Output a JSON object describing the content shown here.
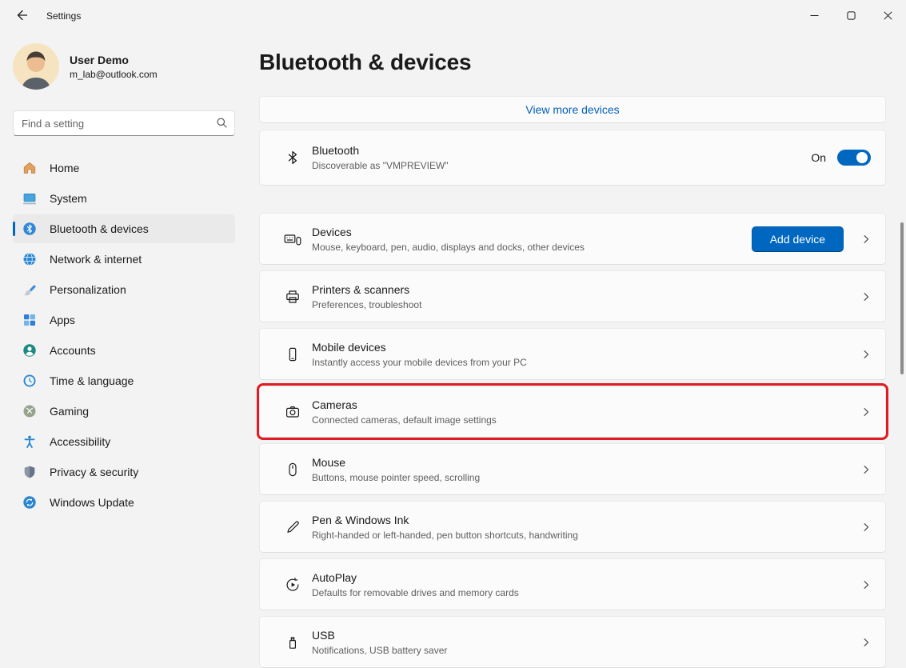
{
  "titlebar": {
    "title": "Settings",
    "controls": [
      {
        "icon": "minimize-icon"
      },
      {
        "icon": "maximize-icon"
      },
      {
        "icon": "close-icon"
      }
    ],
    "back_icon": "back-arrow-icon"
  },
  "user": {
    "name": "User Demo",
    "email": "m_lab@outlook.com",
    "avatar_icon": "user-avatar"
  },
  "search": {
    "placeholder": "Find a setting",
    "icon": "search-icon"
  },
  "sidebar": {
    "items": [
      {
        "label": "Home",
        "icon": "home-icon",
        "selected": false
      },
      {
        "label": "System",
        "icon": "system-icon",
        "selected": false
      },
      {
        "label": "Bluetooth & devices",
        "icon": "bluetooth-icon",
        "selected": true
      },
      {
        "label": "Network & internet",
        "icon": "network-icon",
        "selected": false
      },
      {
        "label": "Personalization",
        "icon": "personalization-icon",
        "selected": false
      },
      {
        "label": "Apps",
        "icon": "apps-icon",
        "selected": false
      },
      {
        "label": "Accounts",
        "icon": "accounts-icon",
        "selected": false
      },
      {
        "label": "Time & language",
        "icon": "time-language-icon",
        "selected": false
      },
      {
        "label": "Gaming",
        "icon": "gaming-icon",
        "selected": false
      },
      {
        "label": "Accessibility",
        "icon": "accessibility-icon",
        "selected": false
      },
      {
        "label": "Privacy & security",
        "icon": "privacy-icon",
        "selected": false
      },
      {
        "label": "Windows Update",
        "icon": "windows-update-icon",
        "selected": false
      }
    ]
  },
  "main": {
    "page_title": "Bluetooth & devices",
    "view_more_label": "View more devices",
    "bluetooth": {
      "title": "Bluetooth",
      "subtitle": "Discoverable as \"VMPREVIEW\"",
      "status_label": "On",
      "toggle_state": true,
      "icon": "bluetooth-glyph-icon"
    },
    "rows": [
      {
        "title": "Devices",
        "subtitle": "Mouse, keyboard, pen, audio, displays and docks, other devices",
        "icon": "devices-icon",
        "button_label": "Add device"
      },
      {
        "title": "Printers & scanners",
        "subtitle": "Preferences, troubleshoot",
        "icon": "printer-icon"
      },
      {
        "title": "Mobile devices",
        "subtitle": "Instantly access your mobile devices from your PC",
        "icon": "mobile-devices-icon"
      },
      {
        "title": "Cameras",
        "subtitle": "Connected cameras, default image settings",
        "icon": "camera-icon",
        "highlighted": true
      },
      {
        "title": "Mouse",
        "subtitle": "Buttons, mouse pointer speed, scrolling",
        "icon": "mouse-icon"
      },
      {
        "title": "Pen & Windows Ink",
        "subtitle": "Right-handed or left-handed, pen button shortcuts, handwriting",
        "icon": "pen-icon"
      },
      {
        "title": "AutoPlay",
        "subtitle": "Defaults for removable drives and memory cards",
        "icon": "autoplay-icon"
      },
      {
        "title": "USB",
        "subtitle": "Notifications, USB battery saver",
        "icon": "usb-icon"
      }
    ]
  },
  "colors": {
    "accent": "#0067c0",
    "link": "#005fb8",
    "highlight_border": "#e01b24",
    "background": "#f3f3f3",
    "card": "#fbfbfb"
  }
}
